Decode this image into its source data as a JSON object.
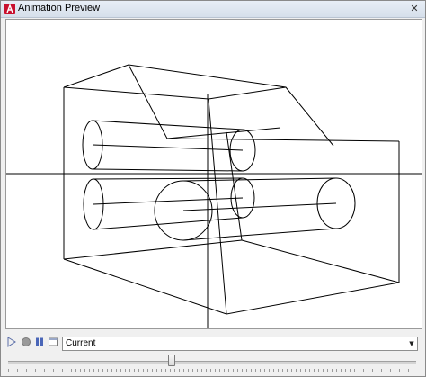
{
  "window": {
    "title": "Animation Preview",
    "close_symbol": "✕",
    "app_icon": "autocad-a-icon",
    "accent_color": "#c8102e"
  },
  "controls": {
    "play_icon": "play-icon",
    "stop_icon": "stop-record-icon",
    "pause_icon": "pause-icon",
    "window_icon": "window-icon",
    "visual_style": {
      "value": "Current"
    },
    "timeline": {
      "position": 0.4
    }
  }
}
